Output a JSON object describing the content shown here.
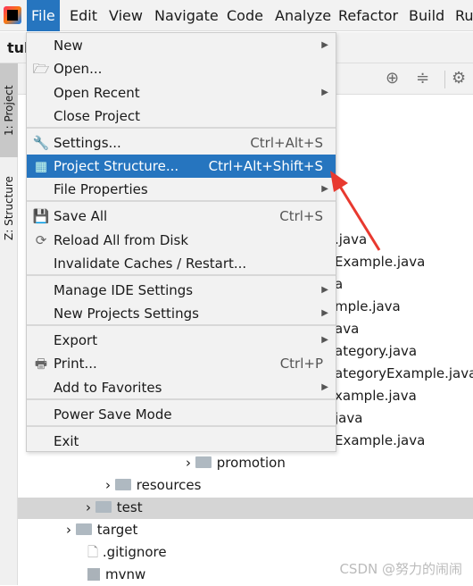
{
  "menubar": {
    "items": [
      "File",
      "Edit",
      "View",
      "Navigate",
      "Code",
      "Analyze",
      "Refactor",
      "Build",
      "Ru"
    ],
    "active": "File"
  },
  "navbar": {
    "project": "tul"
  },
  "side_tabs": {
    "project": "1: Project",
    "structure": "Z: Structure"
  },
  "toolbar": {
    "icons": [
      "locate-icon",
      "collapse-icon",
      "gear-icon"
    ]
  },
  "file_menu": [
    {
      "label": "New",
      "submenu": true
    },
    {
      "label": "Open...",
      "icon": "folder-open-icon"
    },
    {
      "label": "Open Recent",
      "submenu": true
    },
    {
      "label": "Close Project"
    },
    {
      "label": "Settings...",
      "shortcut": "Ctrl+Alt+S",
      "icon": "wrench-icon"
    },
    {
      "label": "Project Structure...",
      "shortcut": "Ctrl+Alt+Shift+S",
      "icon": "project-structure-icon",
      "highlighted": true
    },
    {
      "label": "File Properties",
      "submenu": true
    },
    {
      "label": "Save All",
      "shortcut": "Ctrl+S",
      "icon": "save-icon"
    },
    {
      "label": "Reload All from Disk",
      "icon": "reload-icon"
    },
    {
      "label": "Invalidate Caches / Restart..."
    },
    {
      "label": "Manage IDE Settings",
      "submenu": true
    },
    {
      "label": "New Projects Settings",
      "submenu": true
    },
    {
      "label": "Export",
      "submenu": true
    },
    {
      "label": "Print...",
      "shortcut": "Ctrl+P",
      "icon": "print-icon"
    },
    {
      "label": "Add to Favorites",
      "submenu": true
    },
    {
      "label": "Power Save Mode"
    },
    {
      "label": "Exit"
    }
  ],
  "tree_fragments": [
    ".java",
    "Example.java",
    "a",
    "mple.java",
    "ava",
    "ategory.java",
    "ategoryExample.java",
    "xample.java",
    "java",
    "Example.java"
  ],
  "tree": {
    "promotion": "promotion",
    "resources": "resources",
    "test": "test",
    "target": "target",
    "gitignore": ".gitignore",
    "mvnw": "mvnw"
  },
  "watermark": "CSDN @努力的闹闹",
  "colors": {
    "accent": "#2675bf",
    "arrow": "#e8392f"
  }
}
